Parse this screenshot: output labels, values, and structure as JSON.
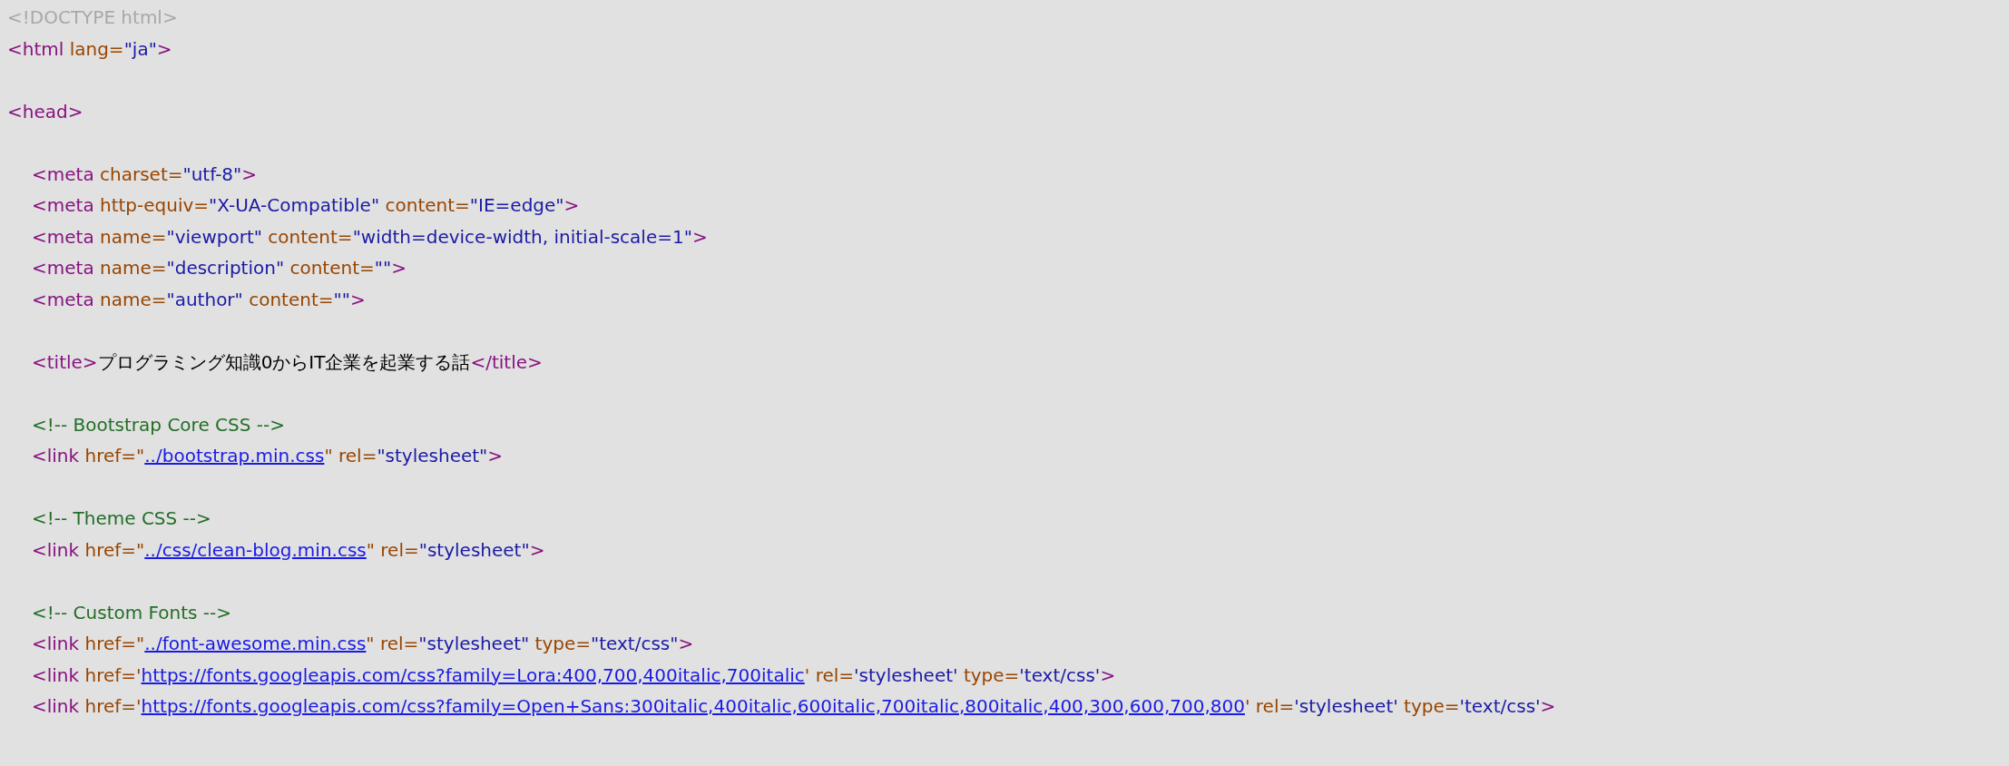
{
  "source": [
    {
      "kind": "code",
      "tokens": [
        {
          "kind": "doctype",
          "text": "<!DOCTYPE html>"
        }
      ]
    },
    {
      "kind": "code",
      "tokens": [
        {
          "kind": "tag",
          "text": "<html "
        },
        {
          "kind": "attr",
          "text": "lang="
        },
        {
          "kind": "value",
          "text": "\"ja\""
        },
        {
          "kind": "tag",
          "text": ">"
        }
      ]
    },
    {
      "kind": "blank"
    },
    {
      "kind": "code",
      "tokens": [
        {
          "kind": "tag",
          "text": "<head>"
        }
      ],
      "children": [
        {
          "kind": "blank"
        },
        {
          "kind": "code",
          "tokens": [
            {
              "kind": "tag",
              "text": "<meta "
            },
            {
              "kind": "attr",
              "text": "charset="
            },
            {
              "kind": "value",
              "text": "\"utf-8\""
            },
            {
              "kind": "tag",
              "text": ">"
            }
          ]
        },
        {
          "kind": "code",
          "tokens": [
            {
              "kind": "tag",
              "text": "<meta "
            },
            {
              "kind": "attr",
              "text": "http-equiv="
            },
            {
              "kind": "value",
              "text": "\"X-UA-Compatible\" "
            },
            {
              "kind": "attr",
              "text": "content="
            },
            {
              "kind": "value",
              "text": "\"IE=edge\""
            },
            {
              "kind": "tag",
              "text": ">"
            }
          ]
        },
        {
          "kind": "code",
          "tokens": [
            {
              "kind": "tag",
              "text": "<meta "
            },
            {
              "kind": "attr",
              "text": "name="
            },
            {
              "kind": "value",
              "text": "\"viewport\" "
            },
            {
              "kind": "attr",
              "text": "content="
            },
            {
              "kind": "value",
              "text": "\"width=device-width, initial-scale=1\""
            },
            {
              "kind": "tag",
              "text": ">"
            }
          ]
        },
        {
          "kind": "code",
          "tokens": [
            {
              "kind": "tag",
              "text": "<meta "
            },
            {
              "kind": "attr",
              "text": "name="
            },
            {
              "kind": "value",
              "text": "\"description\" "
            },
            {
              "kind": "attr",
              "text": "content="
            },
            {
              "kind": "value",
              "text": "\"\""
            },
            {
              "kind": "tag",
              "text": ">"
            }
          ]
        },
        {
          "kind": "code",
          "tokens": [
            {
              "kind": "tag",
              "text": "<meta "
            },
            {
              "kind": "attr",
              "text": "name="
            },
            {
              "kind": "value",
              "text": "\"author\" "
            },
            {
              "kind": "attr",
              "text": "content="
            },
            {
              "kind": "value",
              "text": "\"\""
            },
            {
              "kind": "tag",
              "text": ">"
            }
          ]
        },
        {
          "kind": "blank"
        },
        {
          "kind": "code",
          "tokens": [
            {
              "kind": "tag",
              "text": "<title>"
            },
            {
              "kind": "text",
              "text": "プログラミング知識0からIT企業を起業する話"
            },
            {
              "kind": "tag",
              "text": "</title>"
            }
          ]
        },
        {
          "kind": "blank"
        },
        {
          "kind": "code",
          "tokens": [
            {
              "kind": "comment",
              "text": "<!-- Bootstrap Core CSS -->"
            }
          ]
        },
        {
          "kind": "code",
          "tokens": [
            {
              "kind": "tag",
              "text": "<link "
            },
            {
              "kind": "attr",
              "text": "href=\""
            },
            {
              "kind": "link",
              "text": "../bootstrap.min.css"
            },
            {
              "kind": "attr",
              "text": "\" "
            },
            {
              "kind": "attr",
              "text": "rel="
            },
            {
              "kind": "value",
              "text": "\"stylesheet\""
            },
            {
              "kind": "tag",
              "text": ">"
            }
          ]
        },
        {
          "kind": "blank"
        },
        {
          "kind": "code",
          "tokens": [
            {
              "kind": "comment",
              "text": "<!-- Theme CSS -->"
            }
          ]
        },
        {
          "kind": "code",
          "tokens": [
            {
              "kind": "tag",
              "text": "<link "
            },
            {
              "kind": "attr",
              "text": "href=\""
            },
            {
              "kind": "link",
              "text": "../css/clean-blog.min.css"
            },
            {
              "kind": "attr",
              "text": "\" "
            },
            {
              "kind": "attr",
              "text": "rel="
            },
            {
              "kind": "value",
              "text": "\"stylesheet\""
            },
            {
              "kind": "tag",
              "text": ">"
            }
          ]
        },
        {
          "kind": "blank"
        },
        {
          "kind": "code",
          "tokens": [
            {
              "kind": "comment",
              "text": "<!-- Custom Fonts -->"
            }
          ]
        },
        {
          "kind": "code",
          "tokens": [
            {
              "kind": "tag",
              "text": "<link "
            },
            {
              "kind": "attr",
              "text": "href=\""
            },
            {
              "kind": "link",
              "text": "../font-awesome.min.css"
            },
            {
              "kind": "attr",
              "text": "\" "
            },
            {
              "kind": "attr",
              "text": "rel="
            },
            {
              "kind": "value",
              "text": "\"stylesheet\" "
            },
            {
              "kind": "attr",
              "text": "type="
            },
            {
              "kind": "value",
              "text": "\"text/css\""
            },
            {
              "kind": "tag",
              "text": ">"
            }
          ]
        },
        {
          "kind": "code",
          "tokens": [
            {
              "kind": "tag",
              "text": "<link "
            },
            {
              "kind": "attr",
              "text": "href='"
            },
            {
              "kind": "link",
              "text": "https://fonts.googleapis.com/css?family=Lora:400,700,400italic,700italic"
            },
            {
              "kind": "attr",
              "text": "' "
            },
            {
              "kind": "attr",
              "text": "rel="
            },
            {
              "kind": "value",
              "text": "'stylesheet' "
            },
            {
              "kind": "attr",
              "text": "type="
            },
            {
              "kind": "value",
              "text": "'text/css'"
            },
            {
              "kind": "tag",
              "text": ">"
            }
          ]
        },
        {
          "kind": "code",
          "tokens": [
            {
              "kind": "tag",
              "text": "<link "
            },
            {
              "kind": "attr",
              "text": "href='"
            },
            {
              "kind": "link",
              "text": "https://fonts.googleapis.com/css?family=Open+Sans:300italic,400italic,600italic,700italic,800italic,400,300,600,700,800"
            },
            {
              "kind": "attr",
              "text": "' "
            },
            {
              "kind": "attr",
              "text": "rel="
            },
            {
              "kind": "value",
              "text": "'stylesheet' "
            },
            {
              "kind": "attr",
              "text": "type="
            },
            {
              "kind": "value",
              "text": "'text/css'"
            },
            {
              "kind": "tag",
              "text": ">"
            }
          ]
        }
      ]
    }
  ]
}
